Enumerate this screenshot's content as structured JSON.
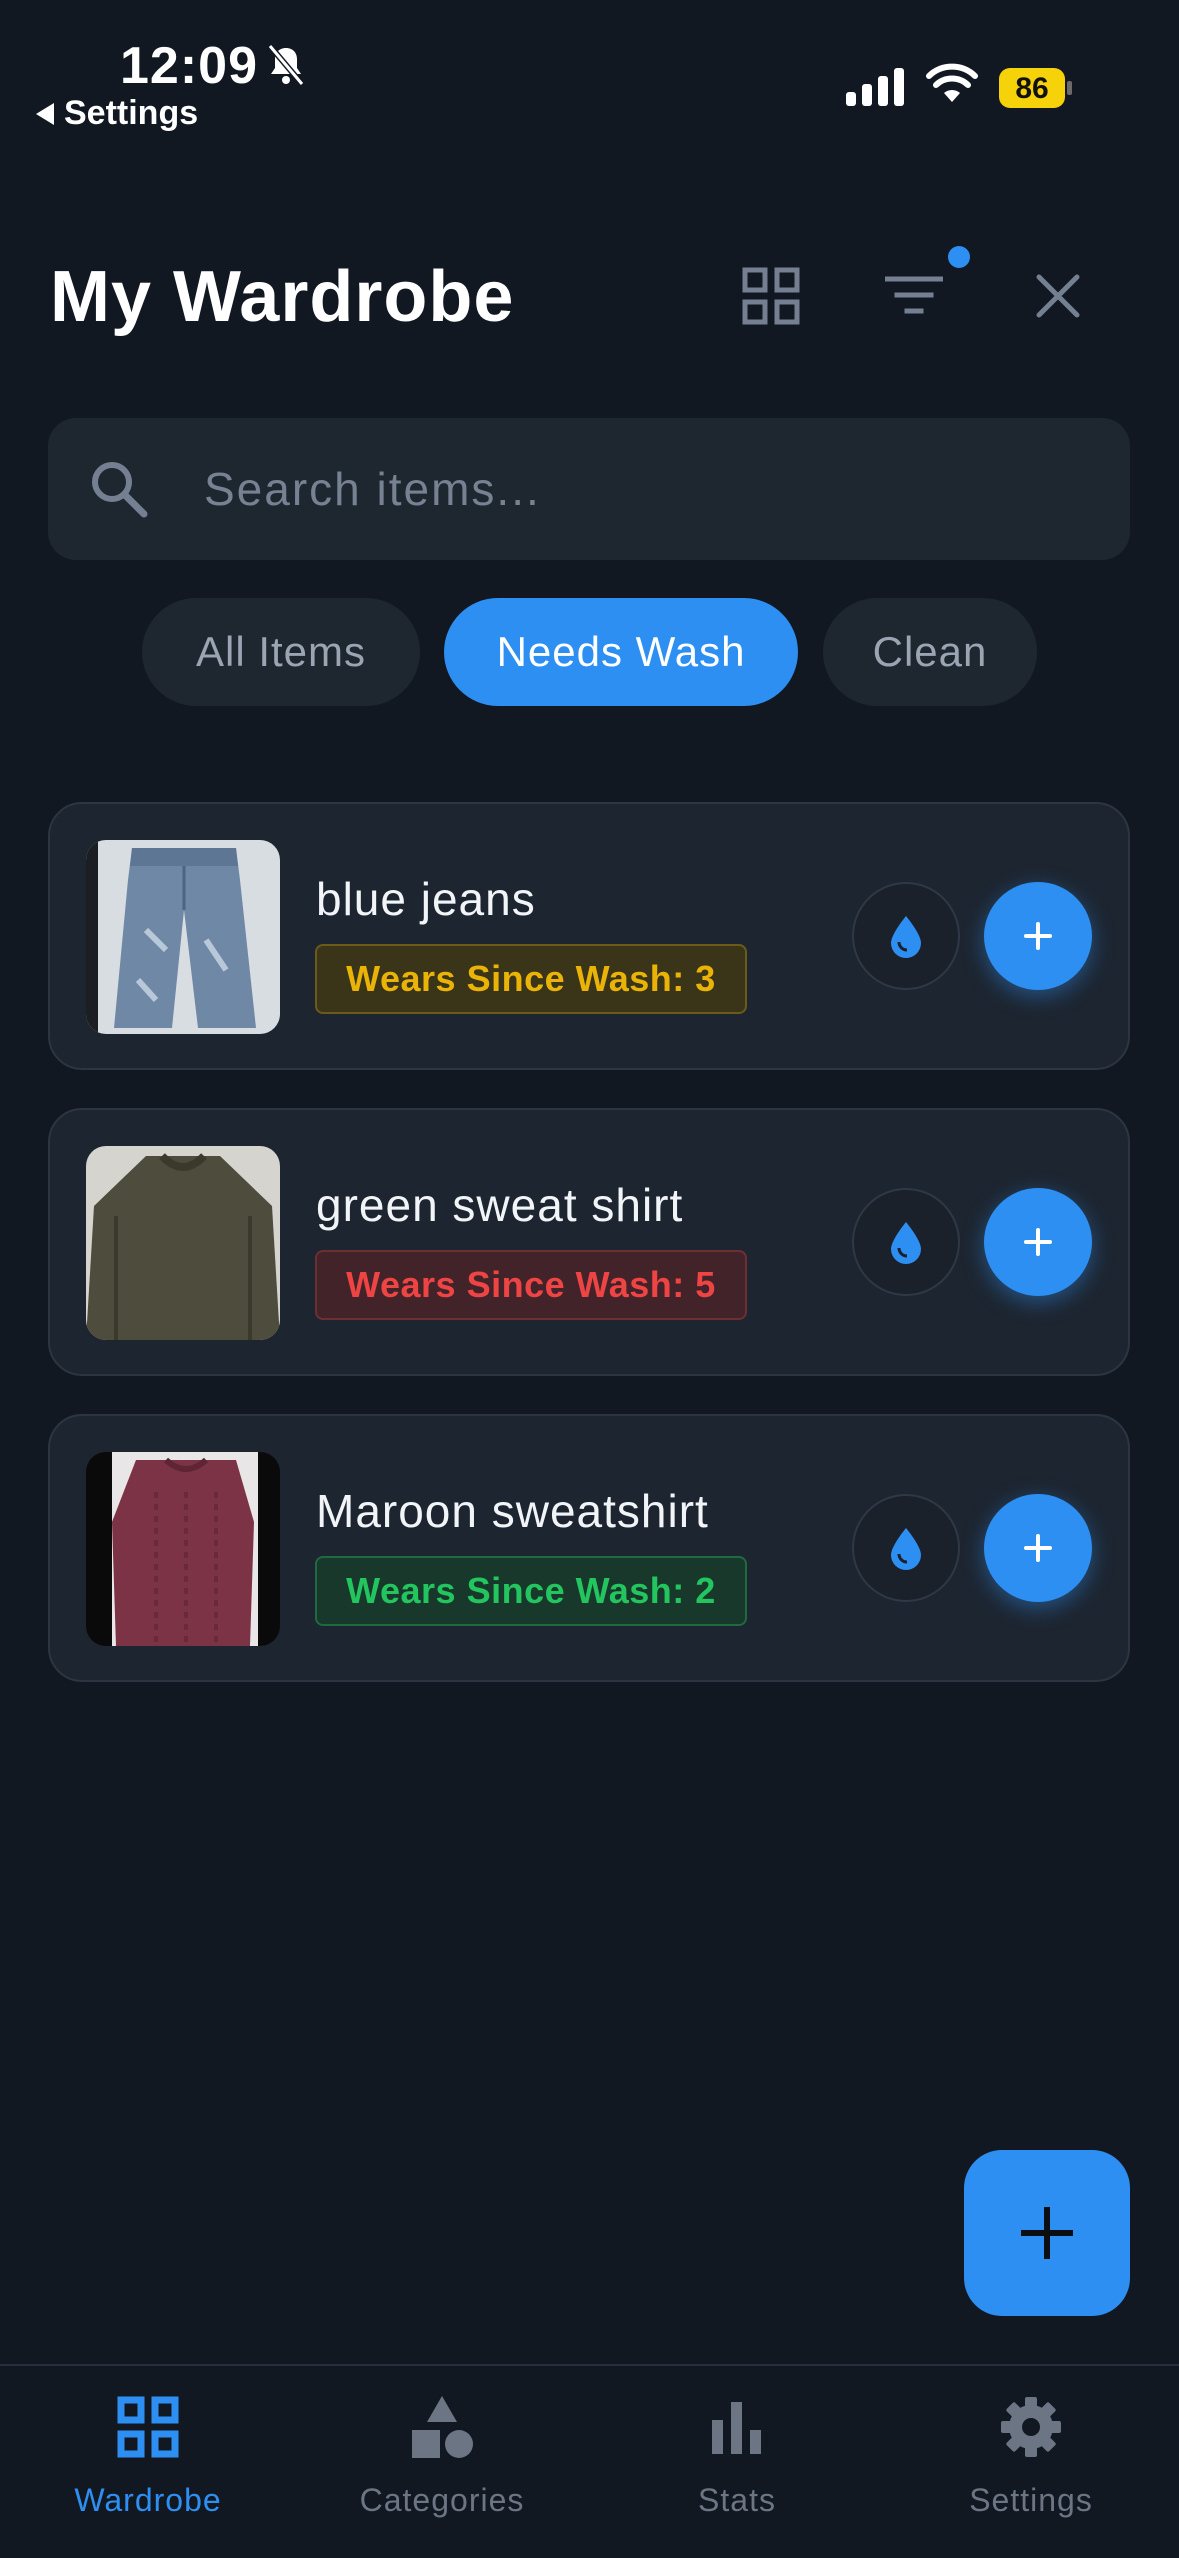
{
  "status_bar": {
    "time": "12:09",
    "back_label": "Settings",
    "battery": "86",
    "icons": [
      "bell-slash-icon",
      "cellular-signal-icon",
      "wifi-icon",
      "battery-icon"
    ]
  },
  "header": {
    "title": "My Wardrobe",
    "icons": [
      "grid-view-icon",
      "filter-icon",
      "close-icon"
    ],
    "filter_active": true
  },
  "search": {
    "placeholder": "Search items...",
    "value": ""
  },
  "filters": [
    {
      "label": "All Items",
      "active": false
    },
    {
      "label": "Needs Wash",
      "active": true
    },
    {
      "label": "Clean",
      "active": false
    }
  ],
  "items": [
    {
      "name": "blue jeans",
      "badge": "Wears Since Wash: 3",
      "badge_color": "#eab308",
      "thumbnail": "blue-jeans-photo"
    },
    {
      "name": "green sweat shirt",
      "badge": "Wears Since Wash: 5",
      "badge_color": "#ef4444",
      "thumbnail": "green-sweatshirt-photo"
    },
    {
      "name": "Maroon sweatshirt",
      "badge": "Wears Since Wash: 2",
      "badge_color": "#22c55e",
      "thumbnail": "maroon-sweatshirt-photo"
    }
  ],
  "fab": {
    "icon": "plus-icon"
  },
  "bottom_nav": [
    {
      "label": "Wardrobe",
      "icon": "wardrobe-grid-icon",
      "active": true
    },
    {
      "label": "Categories",
      "icon": "categories-shapes-icon",
      "active": false
    },
    {
      "label": "Stats",
      "icon": "bar-chart-icon",
      "active": false
    },
    {
      "label": "Settings",
      "icon": "gear-icon",
      "active": false
    }
  ],
  "colors": {
    "background": "#111822",
    "surface": "#1e2630",
    "accent": "#2e8ff2"
  }
}
